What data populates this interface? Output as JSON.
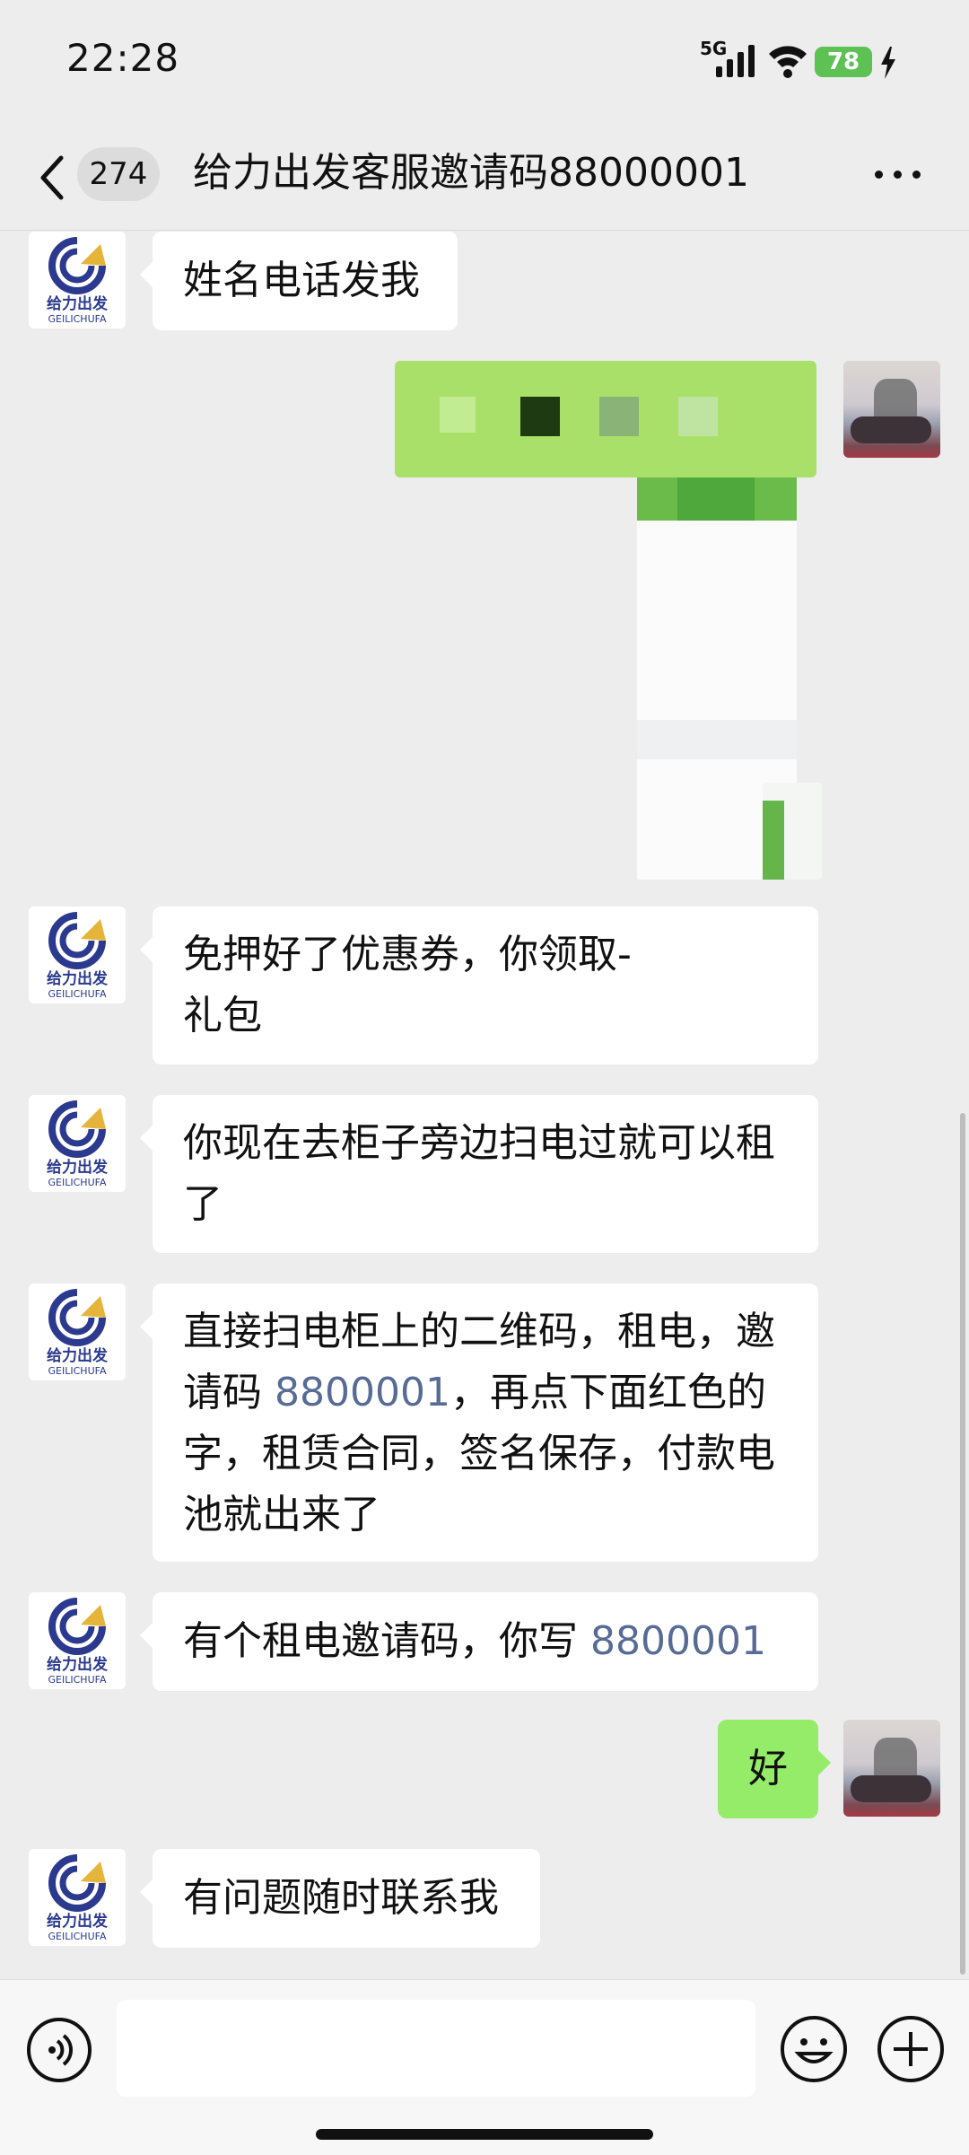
{
  "status_bar": {
    "time": "22:28",
    "network": "5G",
    "battery": "78"
  },
  "nav": {
    "unread_count": "274",
    "title": "给力出发客服邀请码88000001"
  },
  "contact": {
    "logo_text": "给力出发",
    "logo_subtext": "GEILICHUFA"
  },
  "messages": [
    {
      "sender": "agent",
      "text": "姓名电话发我"
    },
    {
      "sender": "user",
      "type": "image_redacted"
    },
    {
      "sender": "agent",
      "line1": "免押好了优惠券，你领取-",
      "line2": "礼包"
    },
    {
      "sender": "agent",
      "line1": "你现在去柜子旁边扫电过就可以租",
      "line2": "了"
    },
    {
      "sender": "agent",
      "line1": "直接扫电柜上的二维码，租电，邀",
      "line2_pre": "请码 ",
      "line2_code": "8800001",
      "line2_post": "，再点下面红色的",
      "line3": "字，租赁合同，签名保存，付款电",
      "line4": "池就出来了"
    },
    {
      "sender": "agent",
      "pre": "有个租电邀请码，你写 ",
      "code": "8800001"
    },
    {
      "sender": "user",
      "text": "好"
    },
    {
      "sender": "agent",
      "text": "有问题随时联系我"
    }
  ],
  "colors": {
    "bubble_user": "#95ec69",
    "bubble_agent": "#ffffff",
    "background": "#ededed",
    "link": "#576b95"
  }
}
